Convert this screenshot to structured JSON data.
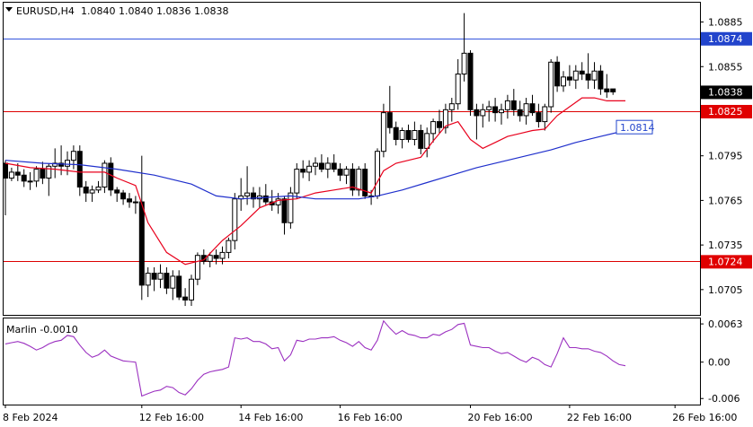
{
  "header": {
    "symbol": "EURUSD,H4",
    "ohlc": "1.0840 1.0840 1.0836 1.0838",
    "indicator": "Marlin -0.0010"
  },
  "colors": {
    "candle": "#000000",
    "ma_fast": "#e8001c",
    "ma_slow": "#1f2fcc",
    "marlin": "#9b30c0",
    "level_blue": "#3355dd",
    "level_red": "#dd0000",
    "label_red_bg": "#e00000",
    "label_blue_bg": "#2244cc",
    "current_bg": "#000000"
  },
  "chart_data": [
    {
      "type": "candlestick",
      "y_range": [
        1.0688,
        1.0898
      ],
      "y_ticks": [
        "1.0885",
        "1.0855",
        "1.0795",
        "1.0765",
        "1.0735",
        "1.0705"
      ],
      "current_price": "1.0838",
      "levels": [
        {
          "value": 1.0874,
          "label": "1.0874",
          "color": "blue"
        },
        {
          "value": 1.0825,
          "label": "1.0825",
          "color": "red"
        },
        {
          "value": 1.0724,
          "label": "1.0724",
          "color": "red"
        }
      ],
      "projection": {
        "value": 1.0814,
        "label": "1.0814"
      },
      "x_labels": [
        "8 Feb 2024",
        "12 Feb 16:00",
        "14 Feb 16:00",
        "16 Feb 16:00",
        "20 Feb 16:00",
        "22 Feb 16:00",
        "26 Feb 16:00"
      ],
      "x_label_index": [
        0,
        22,
        38,
        54,
        75,
        91,
        108
      ],
      "candles": [
        [
          1.079,
          1.0792,
          1.0755,
          1.078
        ],
        [
          1.078,
          1.0787,
          1.0778,
          1.0784
        ],
        [
          1.0784,
          1.079,
          1.0778,
          1.0782
        ],
        [
          1.0782,
          1.0786,
          1.0774,
          1.0778
        ],
        [
          1.0778,
          1.0784,
          1.0772,
          1.0778
        ],
        [
          1.0778,
          1.0788,
          1.0774,
          1.0786
        ],
        [
          1.0786,
          1.0791,
          1.0776,
          1.078
        ],
        [
          1.078,
          1.079,
          1.0768,
          1.0788
        ],
        [
          1.0788,
          1.08,
          1.078,
          1.079
        ],
        [
          1.079,
          1.0802,
          1.0782,
          1.0788
        ],
        [
          1.0788,
          1.0798,
          1.0782,
          1.0792
        ],
        [
          1.0792,
          1.0802,
          1.0786,
          1.0798
        ],
        [
          1.0798,
          1.0802,
          1.0768,
          1.0774
        ],
        [
          1.0774,
          1.0778,
          1.0764,
          1.077
        ],
        [
          1.077,
          1.0775,
          1.0764,
          1.0772
        ],
        [
          1.0772,
          1.0778,
          1.077,
          1.0774
        ],
        [
          1.0774,
          1.0792,
          1.077,
          1.079
        ],
        [
          1.079,
          1.0794,
          1.0768,
          1.0772
        ],
        [
          1.0772,
          1.0774,
          1.0764,
          1.077
        ],
        [
          1.077,
          1.0772,
          1.0762,
          1.0766
        ],
        [
          1.0766,
          1.077,
          1.076,
          1.0764
        ],
        [
          1.0764,
          1.0768,
          1.0756,
          1.0764
        ],
        [
          1.0764,
          1.0795,
          1.0698,
          1.0708
        ],
        [
          1.0708,
          1.072,
          1.07,
          1.0716
        ],
        [
          1.0716,
          1.072,
          1.0704,
          1.0712
        ],
        [
          1.0712,
          1.0722,
          1.0706,
          1.0716
        ],
        [
          1.0716,
          1.072,
          1.0702,
          1.0706
        ],
        [
          1.0706,
          1.0718,
          1.0698,
          1.0714
        ],
        [
          1.0714,
          1.0718,
          1.0698,
          1.07
        ],
        [
          1.07,
          1.0706,
          1.0694,
          1.0698
        ],
        [
          1.0698,
          1.0715,
          1.0694,
          1.0712
        ],
        [
          1.0712,
          1.073,
          1.0708,
          1.0728
        ],
        [
          1.0728,
          1.0732,
          1.0722,
          1.0724
        ],
        [
          1.0724,
          1.073,
          1.072,
          1.0728
        ],
        [
          1.0728,
          1.0732,
          1.0722,
          1.0726
        ],
        [
          1.0726,
          1.0734,
          1.0722,
          1.073
        ],
        [
          1.073,
          1.074,
          1.0726,
          1.0738
        ],
        [
          1.0738,
          1.077,
          1.0732,
          1.0766
        ],
        [
          1.0766,
          1.078,
          1.0758,
          1.0768
        ],
        [
          1.0768,
          1.0788,
          1.0762,
          1.077
        ],
        [
          1.077,
          1.0774,
          1.076,
          1.0766
        ],
        [
          1.0766,
          1.0774,
          1.076,
          1.0768
        ],
        [
          1.0768,
          1.0776,
          1.0762,
          1.0764
        ],
        [
          1.0764,
          1.0772,
          1.0758,
          1.0762
        ],
        [
          1.0762,
          1.077,
          1.0756,
          1.0766
        ],
        [
          1.0766,
          1.0768,
          1.0742,
          1.075
        ],
        [
          1.075,
          1.0774,
          1.0746,
          1.077
        ],
        [
          1.077,
          1.079,
          1.0766,
          1.0786
        ],
        [
          1.0786,
          1.0792,
          1.078,
          1.0784
        ],
        [
          1.0784,
          1.0792,
          1.0778,
          1.0788
        ],
        [
          1.0788,
          1.0794,
          1.0782,
          1.079
        ],
        [
          1.079,
          1.0796,
          1.0784,
          1.0786
        ],
        [
          1.0786,
          1.0794,
          1.078,
          1.079
        ],
        [
          1.079,
          1.0796,
          1.0784,
          1.0786
        ],
        [
          1.0786,
          1.079,
          1.0778,
          1.0782
        ],
        [
          1.0782,
          1.0788,
          1.0776,
          1.0786
        ],
        [
          1.0786,
          1.079,
          1.0768,
          1.0772
        ],
        [
          1.0772,
          1.0788,
          1.0768,
          1.0786
        ],
        [
          1.0786,
          1.079,
          1.0766,
          1.0768
        ],
        [
          1.0768,
          1.0772,
          1.0762,
          1.0768
        ],
        [
          1.0768,
          1.08,
          1.0766,
          1.0798
        ],
        [
          1.0798,
          1.083,
          1.0794,
          1.0824
        ],
        [
          1.0824,
          1.0842,
          1.081,
          1.0814
        ],
        [
          1.0814,
          1.0818,
          1.0802,
          1.0806
        ],
        [
          1.0806,
          1.0814,
          1.08,
          1.0812
        ],
        [
          1.0812,
          1.0816,
          1.0804,
          1.0806
        ],
        [
          1.0806,
          1.0818,
          1.0802,
          1.0812
        ],
        [
          1.0812,
          1.0816,
          1.0796,
          1.08
        ],
        [
          1.08,
          1.0814,
          1.0794,
          1.081
        ],
        [
          1.081,
          1.082,
          1.0804,
          1.0818
        ],
        [
          1.0818,
          1.0826,
          1.081,
          1.0814
        ],
        [
          1.0814,
          1.083,
          1.081,
          1.0826
        ],
        [
          1.0826,
          1.0834,
          1.0818,
          1.083
        ],
        [
          1.083,
          1.086,
          1.0826,
          1.085
        ],
        [
          1.085,
          1.0891,
          1.0845,
          1.0864
        ],
        [
          1.0864,
          1.0866,
          1.0822,
          1.0826
        ],
        [
          1.0826,
          1.083,
          1.0806,
          1.0822
        ],
        [
          1.0822,
          1.083,
          1.0814,
          1.0826
        ],
        [
          1.0826,
          1.0832,
          1.0818,
          1.0828
        ],
        [
          1.0828,
          1.0834,
          1.0818,
          1.0824
        ],
        [
          1.0824,
          1.083,
          1.0816,
          1.0826
        ],
        [
          1.0826,
          1.0836,
          1.082,
          1.0832
        ],
        [
          1.0832,
          1.084,
          1.0822,
          1.0826
        ],
        [
          1.0826,
          1.0832,
          1.0818,
          1.0822
        ],
        [
          1.0822,
          1.0834,
          1.0816,
          1.083
        ],
        [
          1.083,
          1.0836,
          1.0822,
          1.0824
        ],
        [
          1.0824,
          1.083,
          1.0814,
          1.0818
        ],
        [
          1.0818,
          1.083,
          1.0812,
          1.0828
        ],
        [
          1.0828,
          1.086,
          1.0824,
          1.0858
        ],
        [
          1.0858,
          1.0862,
          1.0838,
          1.0842
        ],
        [
          1.0842,
          1.0852,
          1.0838,
          1.0848
        ],
        [
          1.0848,
          1.0856,
          1.0842,
          1.0846
        ],
        [
          1.0846,
          1.0856,
          1.084,
          1.0852
        ],
        [
          1.0852,
          1.0858,
          1.0846,
          1.085
        ],
        [
          1.085,
          1.0864,
          1.084,
          1.0846
        ],
        [
          1.0846,
          1.0858,
          1.084,
          1.0852
        ],
        [
          1.0852,
          1.0856,
          1.0836,
          1.084
        ],
        [
          1.084,
          1.085,
          1.0834,
          1.0838
        ],
        [
          1.084,
          1.084,
          1.0836,
          1.0838
        ]
      ],
      "ma_fast": [
        [
          0,
          1.079
        ],
        [
          4,
          1.0787
        ],
        [
          8,
          1.0786
        ],
        [
          12,
          1.0784
        ],
        [
          16,
          1.0784
        ],
        [
          18,
          1.078
        ],
        [
          21,
          1.0775
        ],
        [
          23,
          1.075
        ],
        [
          26,
          1.073
        ],
        [
          29,
          1.0722
        ],
        [
          32,
          1.0725
        ],
        [
          35,
          1.0738
        ],
        [
          38,
          1.0748
        ],
        [
          41,
          1.076
        ],
        [
          44,
          1.0765
        ],
        [
          47,
          1.0766
        ],
        [
          50,
          1.077
        ],
        [
          53,
          1.0772
        ],
        [
          56,
          1.0774
        ],
        [
          59,
          1.077
        ],
        [
          61,
          1.0785
        ],
        [
          63,
          1.079
        ],
        [
          65,
          1.0792
        ],
        [
          67,
          1.0794
        ],
        [
          69,
          1.0805
        ],
        [
          71,
          1.0815
        ],
        [
          73,
          1.0818
        ],
        [
          75,
          1.0806
        ],
        [
          77,
          1.08
        ],
        [
          79,
          1.0804
        ],
        [
          81,
          1.0808
        ],
        [
          83,
          1.081
        ],
        [
          85,
          1.0812
        ],
        [
          87,
          1.0813
        ],
        [
          89,
          1.0822
        ],
        [
          91,
          1.0828
        ],
        [
          93,
          1.0834
        ],
        [
          95,
          1.0834
        ],
        [
          97,
          1.0832
        ],
        [
          100,
          1.0832
        ]
      ],
      "ma_slow": [
        [
          0,
          1.0792
        ],
        [
          6,
          1.079
        ],
        [
          12,
          1.0789
        ],
        [
          18,
          1.0786
        ],
        [
          24,
          1.0782
        ],
        [
          30,
          1.0776
        ],
        [
          34,
          1.0768
        ],
        [
          38,
          1.0766
        ],
        [
          42,
          1.0767
        ],
        [
          46,
          1.0768
        ],
        [
          50,
          1.0766
        ],
        [
          54,
          1.0766
        ],
        [
          57,
          1.0766
        ],
        [
          60,
          1.0768
        ],
        [
          64,
          1.0772
        ],
        [
          68,
          1.0777
        ],
        [
          72,
          1.0782
        ],
        [
          76,
          1.0787
        ],
        [
          80,
          1.0791
        ],
        [
          84,
          1.0795
        ],
        [
          88,
          1.0799
        ],
        [
          92,
          1.0804
        ],
        [
          96,
          1.0808
        ],
        [
          100,
          1.0812
        ]
      ]
    },
    {
      "type": "line",
      "name": "Marlin",
      "y_range": [
        -0.007,
        0.0072
      ],
      "y_ticks": [
        "0.0063",
        "0.00",
        "-0.006"
      ],
      "values": [
        0.003,
        0.0032,
        0.0034,
        0.0031,
        0.0026,
        0.002,
        0.0024,
        0.003,
        0.0034,
        0.0036,
        0.0044,
        0.0042,
        0.0028,
        0.0016,
        0.0008,
        0.0012,
        0.002,
        0.001,
        0.0006,
        0.0002,
        0.0001,
        0.0,
        -0.0056,
        -0.0052,
        -0.0048,
        -0.0046,
        -0.004,
        -0.0042,
        -0.005,
        -0.0054,
        -0.0044,
        -0.003,
        -0.002,
        -0.0016,
        -0.0014,
        -0.0012,
        -0.0008,
        0.004,
        0.0038,
        0.004,
        0.0034,
        0.0034,
        0.003,
        0.0022,
        0.0024,
        0.0002,
        0.0012,
        0.0036,
        0.0034,
        0.0038,
        0.0038,
        0.004,
        0.004,
        0.0042,
        0.0036,
        0.0032,
        0.0026,
        0.0034,
        0.0024,
        0.002,
        0.0036,
        0.0068,
        0.0056,
        0.0046,
        0.0052,
        0.0046,
        0.0044,
        0.004,
        0.004,
        0.0046,
        0.0044,
        0.005,
        0.0054,
        0.0062,
        0.0064,
        0.0028,
        0.0026,
        0.0024,
        0.0024,
        0.0018,
        0.0014,
        0.0016,
        0.001,
        0.0004,
        0.0,
        0.0008,
        0.0004,
        -0.0004,
        -0.0008,
        0.0014,
        0.004,
        0.0024,
        0.0024,
        0.0022,
        0.0022,
        0.0018,
        0.0016,
        0.001,
        0.0002,
        -0.0004,
        -0.0006
      ]
    }
  ]
}
